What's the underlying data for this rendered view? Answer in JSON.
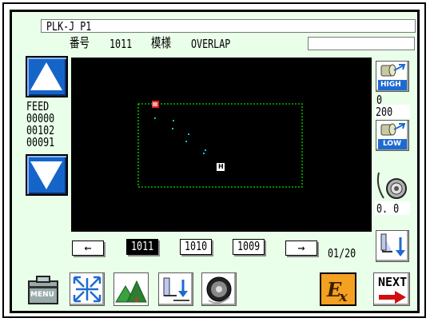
{
  "title": "PLK-J P1",
  "header": {
    "number_label": "番号",
    "number_value": "1011",
    "pattern_label": "模様",
    "pattern_value": "OVERLAP"
  },
  "feed": {
    "label": "FEED",
    "values": [
      "00000",
      "00102",
      "00091"
    ]
  },
  "speed": {
    "high_label": "HIGH",
    "low_label": "LOW",
    "value_top": "0",
    "value_bottom": "200"
  },
  "tension": {
    "value": "0. 0"
  },
  "pager": {
    "prev_arrow": "←",
    "items": [
      "1011",
      "1010",
      "1009"
    ],
    "selected": "1011",
    "next_arrow": "→",
    "page": "01/20"
  },
  "toolbar": {
    "menu_label": "MENU",
    "next_label": "NEXT"
  },
  "preview": {
    "start_marker": "H",
    "colors": {
      "frame": "#00dd00",
      "stitch": "#00cccc",
      "start": "#e02020",
      "background": "#000000"
    }
  }
}
